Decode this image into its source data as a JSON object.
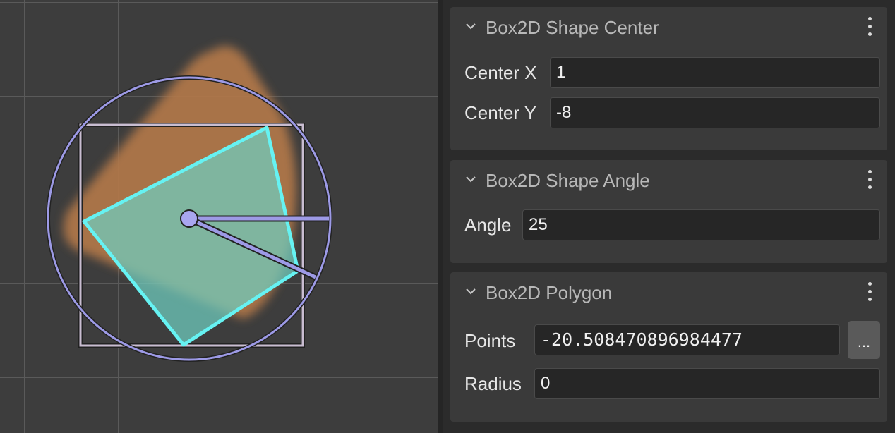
{
  "scene": {
    "shapes": [
      "blurred-orange-triangle-sprite",
      "bounding-box",
      "bounding-circle",
      "cyan-polygon",
      "center-handle",
      "angle-reference-line",
      "angle-rotation-line"
    ],
    "colors": {
      "background": "#3d3d3d",
      "grid": "#5a5a5a",
      "sprite": "#b2784a",
      "polygon_fill": "#7fc9ae",
      "polygon_stroke": "#66f2f2",
      "circle": "#9d9ae6",
      "box": "#c9bdd1"
    }
  },
  "inspector": {
    "panels": [
      {
        "title": "Box2D Shape Center",
        "fields": [
          {
            "label": "Center X",
            "value": "1"
          },
          {
            "label": "Center Y",
            "value": "-8"
          }
        ]
      },
      {
        "title": "Box2D Shape Angle",
        "fields": [
          {
            "label": "Angle",
            "value": "25"
          }
        ]
      },
      {
        "title": "Box2D Polygon",
        "fields": [
          {
            "label": "Points",
            "value": "-20.508470896984477"
          },
          {
            "label": "Radius",
            "value": "0"
          }
        ],
        "points_button": "..."
      }
    ]
  }
}
